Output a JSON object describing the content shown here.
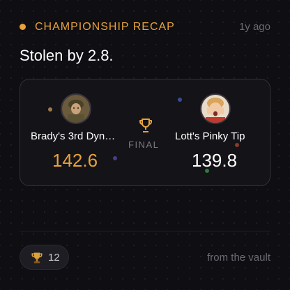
{
  "header": {
    "label": "CHAMPIONSHIP RECAP",
    "timestamp": "1y ago",
    "accent_color": "#e9a23b"
  },
  "headline": "Stolen by 2.8.",
  "matchup": {
    "status_label": "FINAL",
    "status_icon": "trophy-icon",
    "home": {
      "team_name": "Brady's 3rd Dyn…",
      "score": "142.6",
      "avatar": "soldier-avatar",
      "score_color": "#e9a23b"
    },
    "away": {
      "team_name": "Lott's Pinky Tip",
      "score": "139.8",
      "avatar": "screaming-kid-avatar",
      "score_color": "#ffffff"
    }
  },
  "footer": {
    "reaction_icon": "trophy-icon",
    "reaction_count": "12",
    "source_note": "from the vault"
  }
}
